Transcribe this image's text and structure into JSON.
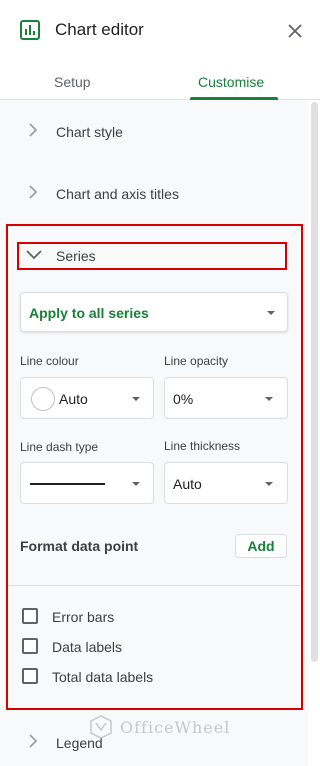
{
  "header": {
    "title": "Chart editor"
  },
  "tabs": [
    {
      "label": "Setup"
    },
    {
      "label": "Customise"
    }
  ],
  "sections": {
    "chart_style": "Chart style",
    "chart_axis_titles": "Chart and axis titles",
    "series": "Series",
    "legend": "Legend"
  },
  "series": {
    "apply_select": "Apply to all series",
    "line_colour": {
      "label": "Line colour",
      "value": "Auto"
    },
    "line_opacity": {
      "label": "Line opacity",
      "value": "0%"
    },
    "line_dash_type": {
      "label": "Line dash type"
    },
    "line_thickness": {
      "label": "Line thickness",
      "value": "Auto"
    },
    "format_data_point": "Format data point",
    "add_button": "Add",
    "checkboxes": [
      {
        "label": "Error bars",
        "checked": false
      },
      {
        "label": "Data labels",
        "checked": false
      },
      {
        "label": "Total data labels",
        "checked": false
      }
    ]
  },
  "watermark": {
    "text": "OfficeWheel"
  },
  "colors": {
    "accent_green": "#188038",
    "highlight_red": "#d50000",
    "panel_bg": "#f8f9fa"
  }
}
